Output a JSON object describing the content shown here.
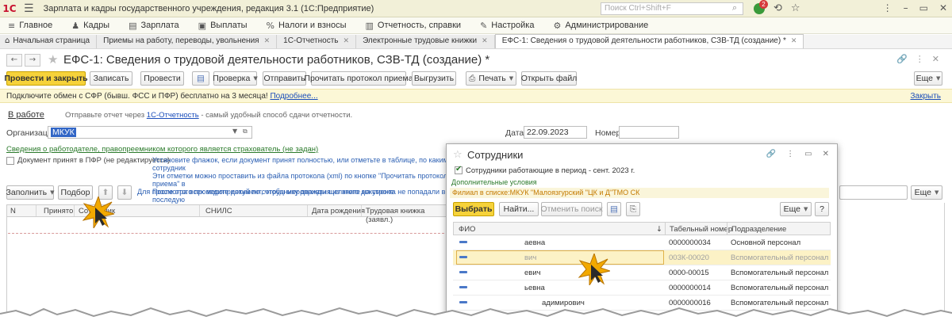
{
  "titlebar": {
    "logo": "1С",
    "title": "Зарплата и кадры государственного учреждения, редакция 3.1  (1С:Предприятие)",
    "search_placeholder": "Поиск Ctrl+Shift+F",
    "notifications": "2"
  },
  "sections": [
    {
      "icon": "≡",
      "label": "Главное"
    },
    {
      "icon": "♟",
      "label": "Кадры"
    },
    {
      "icon": "▤",
      "label": "Зарплата"
    },
    {
      "icon": "▣",
      "label": "Выплаты"
    },
    {
      "icon": "%",
      "label": "Налоги и взносы"
    },
    {
      "icon": "▥",
      "label": "Отчетность, справки"
    },
    {
      "icon": "✎",
      "label": "Настройка"
    },
    {
      "icon": "⚙",
      "label": "Администрирование"
    }
  ],
  "tabs": [
    {
      "label": "Начальная страница"
    },
    {
      "label": "Приемы на работу, переводы, увольнения"
    },
    {
      "label": "1С-Отчетность"
    },
    {
      "label": "Электронные трудовые книжки"
    },
    {
      "label": "ЕФС-1: Сведения о трудовой деятельности работников, СЗВ-ТД (создание) *"
    }
  ],
  "form": {
    "title": "ЕФС-1: Сведения о трудовой деятельности работников, СЗВ-ТД (создание) *",
    "toolbar": {
      "post_close": "Провести и закрыть",
      "save": "Записать",
      "post": "Провести",
      "check": "Проверка",
      "send": "Отправить",
      "read_protocol": "Прочитать протокол приема",
      "upload": "Выгрузить",
      "print": "Печать",
      "open_file": "Открыть файл",
      "more": "Еще"
    },
    "info_text": "Подключите обмен с СФР (бывш. ФСС и ПФР) бесплатно на 3 месяца!",
    "info_link": "Подробнее...",
    "info_close": "Закрыть",
    "status": "В работе",
    "send_note_prefix": "Отправьте отчет через",
    "send_note_link": "1С-Отчетность",
    "send_note_suffix": "- самый удобный способ сдачи отчетности.",
    "org_label": "Организация:",
    "org_value": "МКУК",
    "date_label": "Дата:",
    "date_value": "22.09.2023",
    "number_label": "Номер:",
    "number_value": "",
    "employer_link": "Сведения о работодателе, правопреемником которого является страхователь (не задан)",
    "accepted_label": "Документ принят в ПФР (не редактируется)",
    "note_lines": [
      "Установите флажок, если документ принят полностью, или отметьте в таблице, по каким сотрудник",
      "Эти отметки можно проставить из файла протокола (xml) по кнопке \"Прочитать протокол приема\" в",
      "После этого проведите документ, чтобы мероприятия из этого документа не попадали в последую"
    ],
    "fill_btn": "Заполнить",
    "pick_btn": "Подбор",
    "hint": "Для просмотра всех мероприятий по сотруднику дважды щелкните на строке.",
    "more2": "Еще",
    "columns": [
      "N",
      "Принято",
      "Сотрудник",
      "СНИЛС",
      "Дата рождения",
      "Трудовая книжка (заявл.)"
    ]
  },
  "dialog": {
    "title": "Сотрудники",
    "filter_check_label": "Сотрудники работающие в период - сент. 2023 г.",
    "extra_conditions": "Дополнительные условия",
    "filter_text": "Филиал в списке:МКУК \"Малоязгурский \"ЦК и Д\"ТМО СК",
    "select_btn": "Выбрать",
    "find_btn": "Найти...",
    "cancel_search_btn": "Отменить поиск",
    "more": "Еще",
    "help": "?",
    "columns": [
      "ФИО",
      "Табельный номер",
      "Подразделение"
    ],
    "rows": [
      {
        "name": "аевна",
        "tab": "0000000034",
        "dept": "Основной персонал",
        "selected": false
      },
      {
        "name": "вич",
        "tab": "003К-00020",
        "dept": "Вспомогательный персонал",
        "selected": true
      },
      {
        "name": "евич",
        "tab": "0000-00015",
        "dept": "Вспомогательный персонал",
        "selected": false
      },
      {
        "name": "ьевна",
        "tab": "0000000014",
        "dept": "Вспомогательный персонал",
        "selected": false
      },
      {
        "name": "адимирович",
        "tab": "0000000016",
        "dept": "Вспомогательный персонал",
        "selected": false
      },
      {
        "name": "",
        "tab": "",
        "dept": "",
        "selected": false
      }
    ]
  },
  "colors": {
    "accent": "#f6d23a",
    "link": "#1a4dba",
    "green_link": "#2b7a2b",
    "selection": "#3266c6"
  }
}
